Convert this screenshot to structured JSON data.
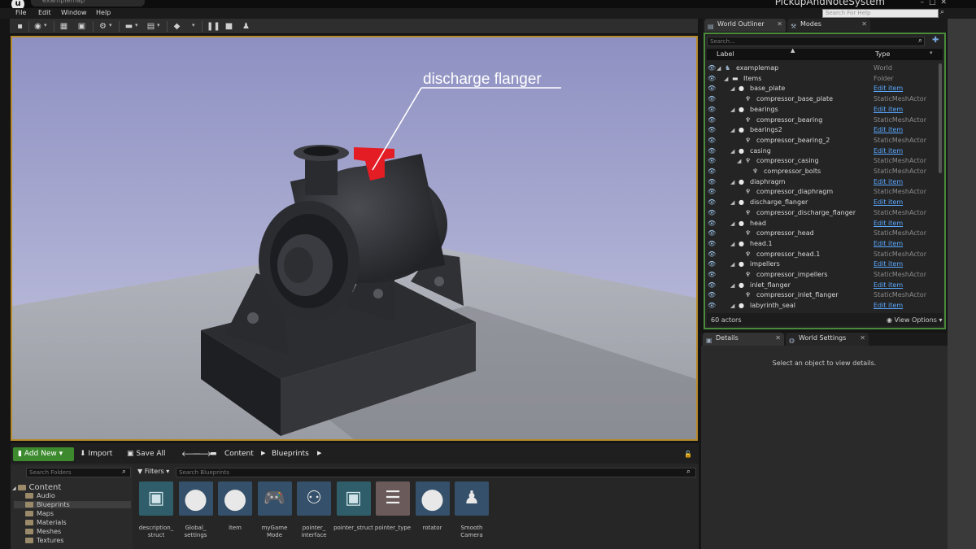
{
  "window": {
    "tab_title": "examplemap",
    "project_name": "PickupAndNoteSystem"
  },
  "menu": {
    "items": [
      "File",
      "Edit",
      "Window",
      "Help"
    ],
    "help_search_placeholder": "Search For Help"
  },
  "viewport": {
    "annotation": "discharge flanger",
    "highlight_color": "#e41d25",
    "frame_color": "#b78a2a"
  },
  "outliner": {
    "tabs": [
      {
        "label": "World Outliner",
        "icon": "outliner-icon"
      },
      {
        "label": "Modes",
        "icon": "modes-icon"
      }
    ],
    "search_placeholder": "Search...",
    "columns": {
      "label": "Label",
      "type": "Type"
    },
    "rows": [
      {
        "label": "examplemap",
        "type": "World",
        "level": 0,
        "kind": "world",
        "link": false
      },
      {
        "label": "Items",
        "type": "Folder",
        "level": 1,
        "kind": "folder",
        "link": false
      },
      {
        "label": "base_plate",
        "type": "Edit item",
        "level": 2,
        "kind": "actor",
        "link": true
      },
      {
        "label": "compressor_base_plate",
        "type": "StaticMeshActor",
        "level": 3,
        "kind": "mesh",
        "link": false
      },
      {
        "label": "bearings",
        "type": "Edit item",
        "level": 2,
        "kind": "actor",
        "link": true
      },
      {
        "label": "compressor_bearing",
        "type": "StaticMeshActor",
        "level": 3,
        "kind": "mesh",
        "link": false
      },
      {
        "label": "bearings2",
        "type": "Edit item",
        "level": 2,
        "kind": "actor",
        "link": true
      },
      {
        "label": "compressor_bearing_2",
        "type": "StaticMeshActor",
        "level": 3,
        "kind": "mesh",
        "link": false
      },
      {
        "label": "casing",
        "type": "Edit item",
        "level": 2,
        "kind": "actor",
        "link": true
      },
      {
        "label": "compressor_casing",
        "type": "StaticMeshActor",
        "level": 3,
        "kind": "mesh-parent",
        "link": false
      },
      {
        "label": "compressor_bolts",
        "type": "StaticMeshActor",
        "level": 4,
        "kind": "mesh",
        "link": false
      },
      {
        "label": "diaphragm",
        "type": "Edit item",
        "level": 2,
        "kind": "actor",
        "link": true
      },
      {
        "label": "compressor_diaphragm",
        "type": "StaticMeshActor",
        "level": 3,
        "kind": "mesh",
        "link": false
      },
      {
        "label": "discharge_flanger",
        "type": "Edit item",
        "level": 2,
        "kind": "actor",
        "link": true
      },
      {
        "label": "compressor_discharge_flanger",
        "type": "StaticMeshActor",
        "level": 3,
        "kind": "mesh",
        "link": false
      },
      {
        "label": "head",
        "type": "Edit item",
        "level": 2,
        "kind": "actor",
        "link": true
      },
      {
        "label": "compressor_head",
        "type": "StaticMeshActor",
        "level": 3,
        "kind": "mesh",
        "link": false
      },
      {
        "label": "head.1",
        "type": "Edit item",
        "level": 2,
        "kind": "actor",
        "link": true
      },
      {
        "label": "compressor_head.1",
        "type": "StaticMeshActor",
        "level": 3,
        "kind": "mesh",
        "link": false
      },
      {
        "label": "impellers",
        "type": "Edit item",
        "level": 2,
        "kind": "actor",
        "link": true
      },
      {
        "label": "compressor_impellers",
        "type": "StaticMeshActor",
        "level": 3,
        "kind": "mesh",
        "link": false
      },
      {
        "label": "inlet_flanger",
        "type": "Edit item",
        "level": 2,
        "kind": "actor",
        "link": true
      },
      {
        "label": "compressor_inlet_flanger",
        "type": "StaticMeshActor",
        "level": 3,
        "kind": "mesh",
        "link": false
      },
      {
        "label": "labyrinth_seal",
        "type": "Edit item",
        "level": 2,
        "kind": "actor",
        "link": true
      }
    ],
    "actor_count": "60 actors",
    "view_options": "View Options",
    "accent_color": "#4a8a3a",
    "link_color": "#5aa8ff"
  },
  "details": {
    "tabs": [
      {
        "label": "Details",
        "icon": "details-icon"
      },
      {
        "label": "World Settings",
        "icon": "world-settings-icon"
      }
    ],
    "empty_message": "Select an object to view details."
  },
  "content_browser": {
    "add_new": "Add New",
    "import": "Import",
    "save_all": "Save All",
    "breadcrumb": [
      "Content",
      "Blueprints"
    ],
    "folder_search_placeholder": "Search Folders",
    "filters_label": "Filters",
    "asset_search_placeholder": "Search Blueprints",
    "folders": [
      {
        "label": "Content",
        "root": true,
        "selected": false
      },
      {
        "label": "Audio",
        "root": false,
        "selected": false
      },
      {
        "label": "Blueprints",
        "root": false,
        "selected": true
      },
      {
        "label": "Maps",
        "root": false,
        "selected": false
      },
      {
        "label": "Materials",
        "root": false,
        "selected": false
      },
      {
        "label": "Meshes",
        "root": false,
        "selected": false
      },
      {
        "label": "Textures",
        "root": false,
        "selected": false
      }
    ],
    "assets": [
      {
        "label": "description_\nstruct",
        "icon": "struct-icon"
      },
      {
        "label": "Global_\nsettings",
        "icon": "sphere-icon"
      },
      {
        "label": "item",
        "icon": "sphere-icon"
      },
      {
        "label": "myGame\nMode",
        "icon": "gamepad-icon"
      },
      {
        "label": "pointer_\ninterface",
        "icon": "interface-icon"
      },
      {
        "label": "pointer_struct",
        "icon": "struct-icon"
      },
      {
        "label": "pointer_type",
        "icon": "enum-icon"
      },
      {
        "label": "rotator",
        "icon": "sphere-icon"
      },
      {
        "label": "Smooth\nCamera",
        "icon": "pawn-icon"
      }
    ],
    "add_new_color": "#3d8a2e"
  }
}
